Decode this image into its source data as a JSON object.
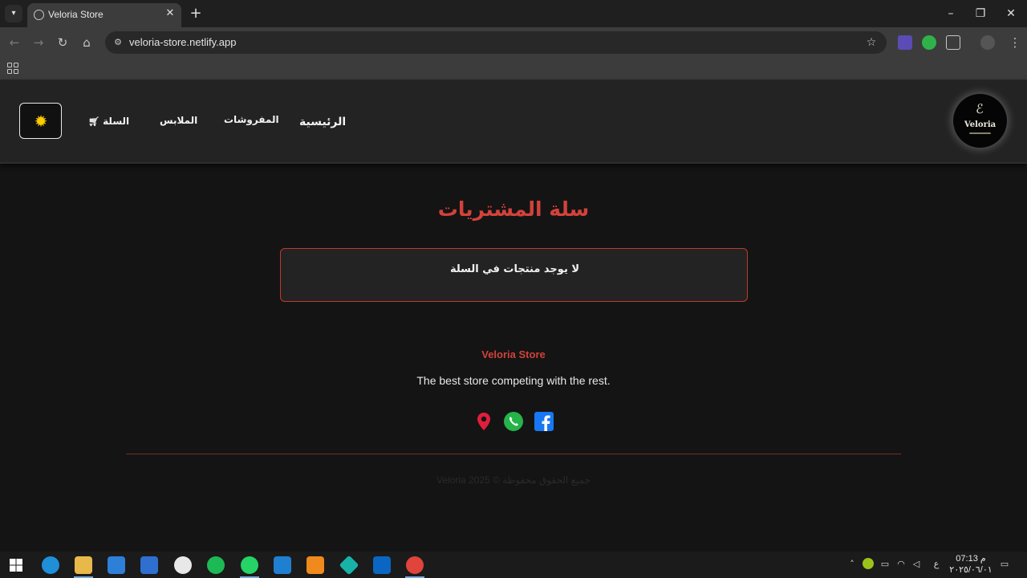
{
  "browser": {
    "tab_title": "Veloria Store",
    "url": "veloria-store.netlify.app",
    "new_tab": "+",
    "close": "✕",
    "minimize": "–",
    "maximize": "❐",
    "window_close": "✕"
  },
  "header": {
    "nav": {
      "home": "الرئيسية",
      "furnishings": "المفروشات",
      "clothing": "الملابس",
      "cart": "السلة"
    },
    "logo_text": "Veloria",
    "theme_icon": "sun-icon"
  },
  "main": {
    "title": "سلة المشتريات",
    "empty_message": "لا يوجد منتجات في السلة"
  },
  "footer": {
    "brand": "Veloria Store",
    "tagline": "The best store competing with the rest.",
    "copyright": "جميع الحقوق محفوظة © Veloria 2025",
    "social_icons": [
      "location-icon",
      "whatsapp-icon",
      "facebook-icon"
    ]
  },
  "taskbar": {
    "time": "07:13 م",
    "date": "٢٠٢٥/٠٦/٠١",
    "lang": "ع"
  },
  "colors": {
    "accent": "#d2423a",
    "header_bg": "#232323",
    "page_bg": "#141414"
  }
}
